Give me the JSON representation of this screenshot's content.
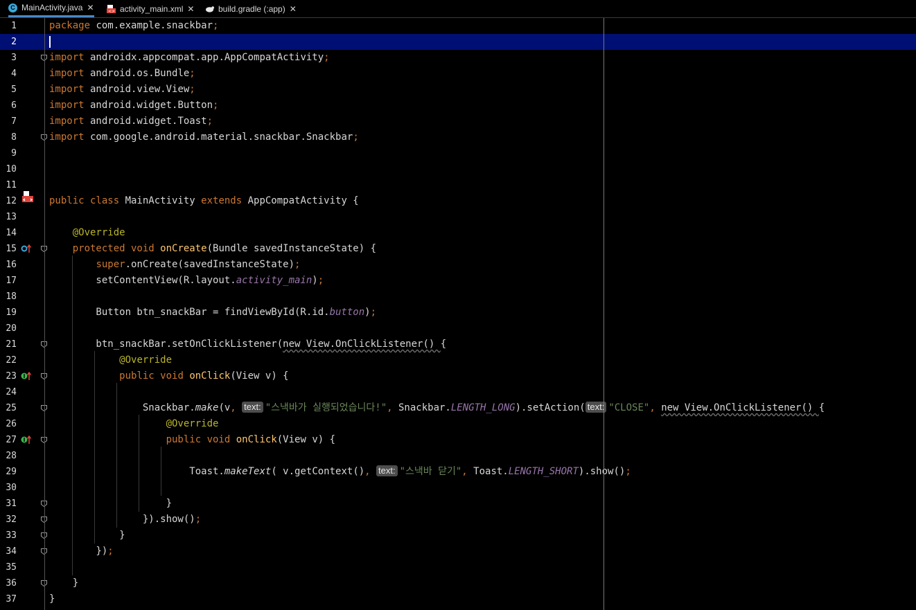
{
  "tabs": [
    {
      "label": "MainActivity.java",
      "icon": "java-class-icon",
      "active": true
    },
    {
      "label": "activity_main.xml",
      "icon": "xml-layout-icon",
      "active": false
    },
    {
      "label": "build.gradle (:app)",
      "icon": "gradle-icon",
      "active": false
    }
  ],
  "colors": {
    "background": "#000000",
    "current_line": "#000f73",
    "keyword": "#cc7832",
    "string": "#6a8759",
    "annotation": "#bbb529",
    "method_decl": "#ffc66d",
    "field": "#9876aa",
    "plain": "#d8d8d8"
  },
  "lines": [
    {
      "n": "1",
      "tokens": [
        {
          "t": "package",
          "c": "keyword"
        },
        {
          "t": " com.example.snackbar",
          "c": "plain"
        },
        {
          "t": ";",
          "c": "keyword"
        }
      ]
    },
    {
      "n": "2",
      "current": true,
      "caret": true,
      "tokens": []
    },
    {
      "n": "3",
      "tokens": [
        {
          "t": "import",
          "c": "keyword"
        },
        {
          "t": " androidx.appcompat.app.AppCompatActivity",
          "c": "plain"
        },
        {
          "t": ";",
          "c": "keyword"
        }
      ]
    },
    {
      "n": "4",
      "tokens": [
        {
          "t": "import",
          "c": "keyword"
        },
        {
          "t": " android.os.Bundle",
          "c": "plain"
        },
        {
          "t": ";",
          "c": "keyword"
        }
      ]
    },
    {
      "n": "5",
      "tokens": [
        {
          "t": "import",
          "c": "keyword"
        },
        {
          "t": " android.view.View",
          "c": "plain"
        },
        {
          "t": ";",
          "c": "keyword"
        }
      ]
    },
    {
      "n": "6",
      "tokens": [
        {
          "t": "import",
          "c": "keyword"
        },
        {
          "t": " android.widget.Button",
          "c": "plain"
        },
        {
          "t": ";",
          "c": "keyword"
        }
      ]
    },
    {
      "n": "7",
      "tokens": [
        {
          "t": "import",
          "c": "keyword"
        },
        {
          "t": " android.widget.Toast",
          "c": "plain"
        },
        {
          "t": ";",
          "c": "keyword"
        }
      ]
    },
    {
      "n": "8",
      "tokens": [
        {
          "t": "import",
          "c": "keyword"
        },
        {
          "t": " com.google.android.material.snackbar.Snackbar",
          "c": "plain"
        },
        {
          "t": ";",
          "c": "keyword"
        }
      ]
    },
    {
      "n": "9",
      "tokens": []
    },
    {
      "n": "10",
      "tokens": []
    },
    {
      "n": "11",
      "tokens": []
    },
    {
      "n": "12",
      "tokens": [
        {
          "t": "public class ",
          "c": "keyword"
        },
        {
          "t": "MainActivity ",
          "c": "plain"
        },
        {
          "t": "extends ",
          "c": "keyword"
        },
        {
          "t": "AppCompatActivity {",
          "c": "plain"
        }
      ]
    },
    {
      "n": "13",
      "tokens": []
    },
    {
      "n": "14",
      "tokens": [
        {
          "t": "    "
        },
        {
          "t": "@Override",
          "c": "annotation"
        }
      ]
    },
    {
      "n": "15",
      "tokens": [
        {
          "t": "    "
        },
        {
          "t": "protected void ",
          "c": "keyword"
        },
        {
          "t": "onCreate",
          "c": "method_decl"
        },
        {
          "t": "(Bundle savedInstanceState) {",
          "c": "plain"
        }
      ]
    },
    {
      "n": "16",
      "tokens": [
        {
          "t": "        "
        },
        {
          "t": "super",
          "c": "keyword"
        },
        {
          "t": ".onCreate(savedInstanceState)",
          "c": "plain"
        },
        {
          "t": ";",
          "c": "keyword"
        }
      ]
    },
    {
      "n": "17",
      "tokens": [
        {
          "t": "        setContentView(R.layout.",
          "c": "plain"
        },
        {
          "t": "activity_main",
          "c": "field",
          "i": true
        },
        {
          "t": ")",
          "c": "plain"
        },
        {
          "t": ";",
          "c": "keyword"
        }
      ]
    },
    {
      "n": "18",
      "tokens": []
    },
    {
      "n": "19",
      "tokens": [
        {
          "t": "        Button btn_snackBar = findViewById(R.id.",
          "c": "plain"
        },
        {
          "t": "button",
          "c": "field",
          "i": true
        },
        {
          "t": ")",
          "c": "plain"
        },
        {
          "t": ";",
          "c": "keyword"
        }
      ]
    },
    {
      "n": "20",
      "tokens": []
    },
    {
      "n": "21",
      "tokens": [
        {
          "t": "        btn_snackBar.setOnClickListener(",
          "c": "plain"
        },
        {
          "t": "new View.OnClickListener() ",
          "c": "plain",
          "u": true
        },
        {
          "t": "{",
          "c": "plain"
        }
      ]
    },
    {
      "n": "22",
      "tokens": [
        {
          "t": "            "
        },
        {
          "t": "@Override",
          "c": "annotation"
        }
      ]
    },
    {
      "n": "23",
      "tokens": [
        {
          "t": "            "
        },
        {
          "t": "public void ",
          "c": "keyword"
        },
        {
          "t": "onClick",
          "c": "method_decl"
        },
        {
          "t": "(View v) {",
          "c": "plain"
        }
      ]
    },
    {
      "n": "24",
      "tokens": []
    },
    {
      "n": "25",
      "tokens": [
        {
          "t": "                Snackbar.",
          "c": "plain"
        },
        {
          "t": "make",
          "c": "plain",
          "i": true
        },
        {
          "t": "(v",
          "c": "plain"
        },
        {
          "t": ", ",
          "c": "keyword"
        },
        {
          "hint": "text:"
        },
        {
          "t": "\"스낵바가 실행되었습니다!\"",
          "c": "string"
        },
        {
          "t": ", ",
          "c": "keyword"
        },
        {
          "t": "Snackbar.",
          "c": "plain"
        },
        {
          "t": "LENGTH_LONG",
          "c": "field",
          "i": true
        },
        {
          "t": ").setAction(",
          "c": "plain"
        },
        {
          "hint": "text:"
        },
        {
          "t": "\"CLOSE\"",
          "c": "string"
        },
        {
          "t": ", ",
          "c": "keyword"
        },
        {
          "t": "new View.OnClickListener() ",
          "c": "plain",
          "u": true
        },
        {
          "t": "{",
          "c": "plain"
        }
      ]
    },
    {
      "n": "26",
      "tokens": [
        {
          "t": "                    "
        },
        {
          "t": "@Override",
          "c": "annotation"
        }
      ]
    },
    {
      "n": "27",
      "tokens": [
        {
          "t": "                    "
        },
        {
          "t": "public void ",
          "c": "keyword"
        },
        {
          "t": "onClick",
          "c": "method_decl"
        },
        {
          "t": "(View v) {",
          "c": "plain"
        }
      ]
    },
    {
      "n": "28",
      "tokens": []
    },
    {
      "n": "29",
      "tokens": [
        {
          "t": "                        Toast.",
          "c": "plain"
        },
        {
          "t": "makeText",
          "c": "plain",
          "i": true
        },
        {
          "t": "( v.getContext()",
          "c": "plain"
        },
        {
          "t": ", ",
          "c": "keyword"
        },
        {
          "hint": "text:"
        },
        {
          "t": "\"스낵바 닫기\"",
          "c": "string"
        },
        {
          "t": ", ",
          "c": "keyword"
        },
        {
          "t": "Toast.",
          "c": "plain"
        },
        {
          "t": "LENGTH_SHORT",
          "c": "field",
          "i": true
        },
        {
          "t": ").show()",
          "c": "plain"
        },
        {
          "t": ";",
          "c": "keyword"
        }
      ]
    },
    {
      "n": "30",
      "tokens": []
    },
    {
      "n": "31",
      "tokens": [
        {
          "t": "                    }",
          "c": "plain"
        }
      ]
    },
    {
      "n": "32",
      "tokens": [
        {
          "t": "                }).show()",
          "c": "plain"
        },
        {
          "t": ";",
          "c": "keyword"
        }
      ]
    },
    {
      "n": "33",
      "tokens": [
        {
          "t": "            }",
          "c": "plain"
        }
      ]
    },
    {
      "n": "34",
      "tokens": [
        {
          "t": "        })",
          "c": "plain"
        },
        {
          "t": ";",
          "c": "keyword"
        }
      ]
    },
    {
      "n": "35",
      "tokens": []
    },
    {
      "n": "36",
      "tokens": [
        {
          "t": "    }",
          "c": "plain"
        }
      ]
    },
    {
      "n": "37",
      "tokens": [
        {
          "t": "}",
          "c": "plain"
        }
      ]
    }
  ],
  "fold_lines": [
    "3",
    "8",
    "15",
    "21",
    "23",
    "25",
    "27",
    "31",
    "32",
    "33",
    "34",
    "36"
  ],
  "gutter_icons": [
    {
      "line": "12",
      "icon": "layout-file-icon"
    },
    {
      "line": "15",
      "icon": "overrides-method-icon"
    },
    {
      "line": "23",
      "icon": "implements-method-icon"
    },
    {
      "line": "27",
      "icon": "implements-method-icon"
    }
  ]
}
